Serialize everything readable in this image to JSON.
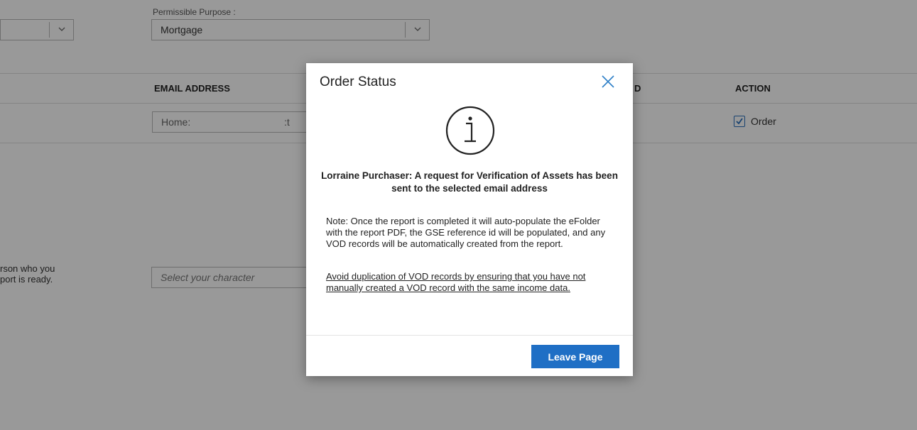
{
  "background": {
    "permissible_purpose": {
      "label": "Permissible Purpose :",
      "value": "Mortgage"
    },
    "table": {
      "headers": {
        "email": "EMAIL ADDRESS",
        "verified_partial": "D",
        "action": "ACTION"
      },
      "row": {
        "email_value": "Home:",
        "email_partial": ":t",
        "action_label": "Order",
        "action_checked": true
      }
    },
    "notify": {
      "text_line1": "rson who you",
      "text_line2": "port is ready.",
      "placeholder": "Select your character"
    }
  },
  "modal": {
    "title": "Order Status",
    "icon": "info-circle-icon",
    "message": "Lorraine Purchaser: A request for Verification of Assets has been sent to the selected email address",
    "note": "Note: Once the report is completed it will auto-populate the eFolder with the report PDF, the GSE reference id will be populated, and any VOD records will be automatically created from the report.",
    "link": "Avoid duplication of VOD records by ensuring that you have not manually created a VOD record with the same income data.",
    "button": "Leave Page"
  },
  "colors": {
    "primary": "#1f6fc5",
    "overlay": "rgba(0,0,0,0.40)"
  }
}
